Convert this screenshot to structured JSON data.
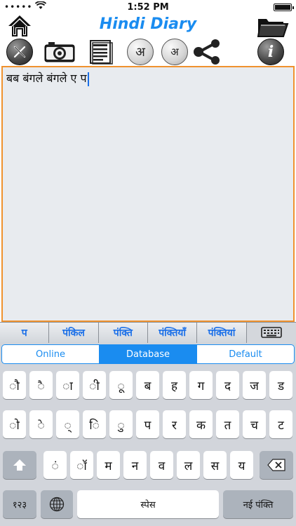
{
  "status": {
    "carrier": "•••••",
    "time": "1:52 PM"
  },
  "app": {
    "title": "Hindi Diary"
  },
  "toolbar": {
    "font_btn_1": "अ",
    "font_btn_2": "अ",
    "info": "i"
  },
  "editor": {
    "text": "बब बंगले बंगले ए प"
  },
  "suggestions": [
    "प",
    "पंकिल",
    "पंक्ति",
    "पंक्तियाँ",
    "पंक्तियां"
  ],
  "modes": {
    "items": [
      "Online",
      "Database",
      "Default"
    ],
    "selected": "Database"
  },
  "keyboard": {
    "row1": [
      "ौ",
      "ै",
      "ा",
      "ी",
      "ू",
      "ब",
      "ह",
      "ग",
      "द",
      "ज",
      "ड"
    ],
    "row2": [
      "ो",
      "े",
      "्",
      "ि",
      "ु",
      "प",
      "र",
      "क",
      "त",
      "च",
      "ट"
    ],
    "row3": [
      "ं",
      "ॉ",
      "म",
      "न",
      "व",
      "ल",
      "स",
      "य"
    ],
    "numbers_label": "१२३",
    "space_label": "स्पेस",
    "return_label": "नई पंक्ति"
  },
  "colors": {
    "accent": "#1a8cf0",
    "editor_border": "#f0922e"
  }
}
